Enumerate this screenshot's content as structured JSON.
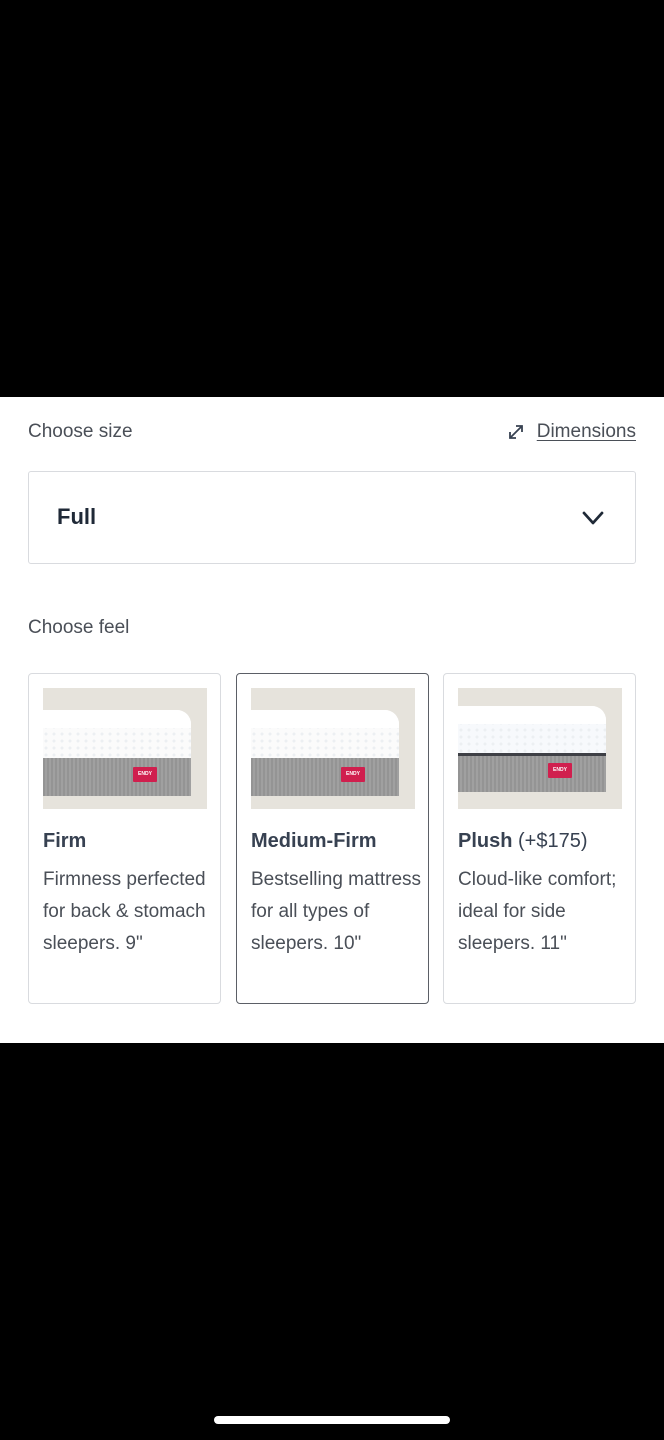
{
  "size": {
    "label": "Choose size",
    "dimensions_link": "Dimensions",
    "selected": "Full"
  },
  "feel": {
    "label": "Choose feel",
    "options": [
      {
        "name": "Firm",
        "extra": "",
        "description": "Firmness perfected for back & stomach sleepers. 9\"",
        "selected": false,
        "brand_tag": "ENDY"
      },
      {
        "name": "Medium-Firm",
        "extra": "",
        "description": "Bestselling mattress for all types of sleepers. 10\"",
        "selected": true,
        "brand_tag": "ENDY"
      },
      {
        "name": "Plush",
        "extra": " (+$175)",
        "description": "Cloud-like comfort; ideal for side sleepers. 11\"",
        "selected": false,
        "brand_tag": "ENDY"
      }
    ]
  },
  "icons": {
    "dimensions": "expand-arrows-icon",
    "dropdown": "chevron-down-icon"
  },
  "colors": {
    "brand_tag": "#d01f4e",
    "text": "#4a4f57",
    "selected_border": "#5b5f66"
  }
}
